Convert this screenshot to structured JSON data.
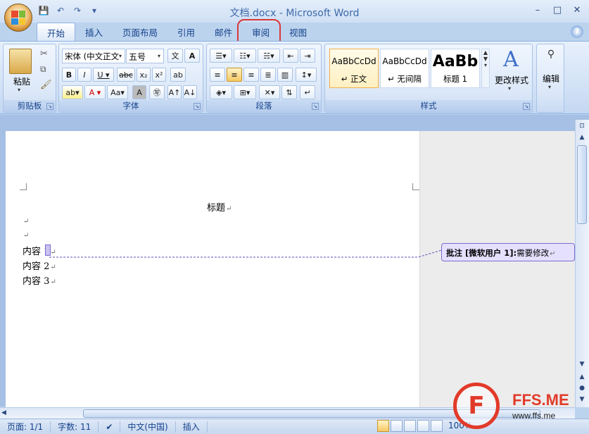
{
  "window": {
    "title": "文档.docx - Microsoft Word",
    "minimize": "–",
    "maximize": "□",
    "close": "✕"
  },
  "qat": {
    "save": "💾",
    "undo": "↶",
    "redo": "↷",
    "customize": "▾"
  },
  "tabs": [
    {
      "label": "开始",
      "active": true
    },
    {
      "label": "插入"
    },
    {
      "label": "页面布局"
    },
    {
      "label": "引用"
    },
    {
      "label": "邮件"
    },
    {
      "label": "审阅",
      "highlighted": true
    },
    {
      "label": "视图"
    }
  ],
  "help": "?",
  "ribbon": {
    "clipboard": {
      "label": "剪贴板",
      "paste": "粘贴"
    },
    "font": {
      "label": "字体",
      "font_name": "宋体 (中文正文",
      "font_size": "五号"
    },
    "paragraph": {
      "label": "段落"
    },
    "styles": {
      "label": "样式",
      "items": [
        {
          "preview": "AaBbCcDd",
          "name": "↵ 正文",
          "selected": true
        },
        {
          "preview": "AaBbCcDd",
          "name": "↵ 无间隔"
        },
        {
          "preview": "AaBb",
          "name": "标题 1"
        }
      ],
      "change": "更改样式"
    },
    "editing": {
      "label": "编辑"
    }
  },
  "document": {
    "title": "标题",
    "lines": [
      "内容 1",
      "内容 2",
      "内容 3"
    ]
  },
  "comment": {
    "prefix": "批注 [微软用户 1]:",
    "text": "需要修改"
  },
  "status": {
    "page": "页面: 1/1",
    "words": "字数: 11",
    "lang": "中文(中国)",
    "mode": "插入",
    "zoom": "100%"
  },
  "watermark": {
    "brand": "FFS.ME",
    "url": "www.ffs.me"
  },
  "colors": {
    "ribbon": "#dce8f8",
    "highlight": "#d9373a",
    "comment_border": "#7c6bd1",
    "brand": "#e23a2a"
  }
}
